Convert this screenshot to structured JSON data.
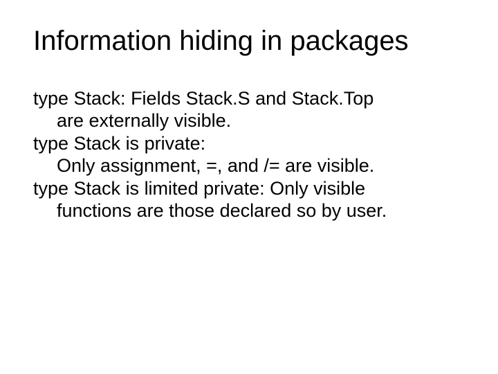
{
  "title": "Information hiding in packages",
  "body": {
    "p1_l1": "type Stack: Fields Stack.S and Stack.Top",
    "p1_l2": "are externally visible.",
    "p2_l1": "type Stack is private:",
    "p2_l2": "Only assignment, =, and /= are visible.",
    "p3_l1": "type Stack is limited private: Only visible",
    "p3_l2": "functions are those declared so by user."
  }
}
